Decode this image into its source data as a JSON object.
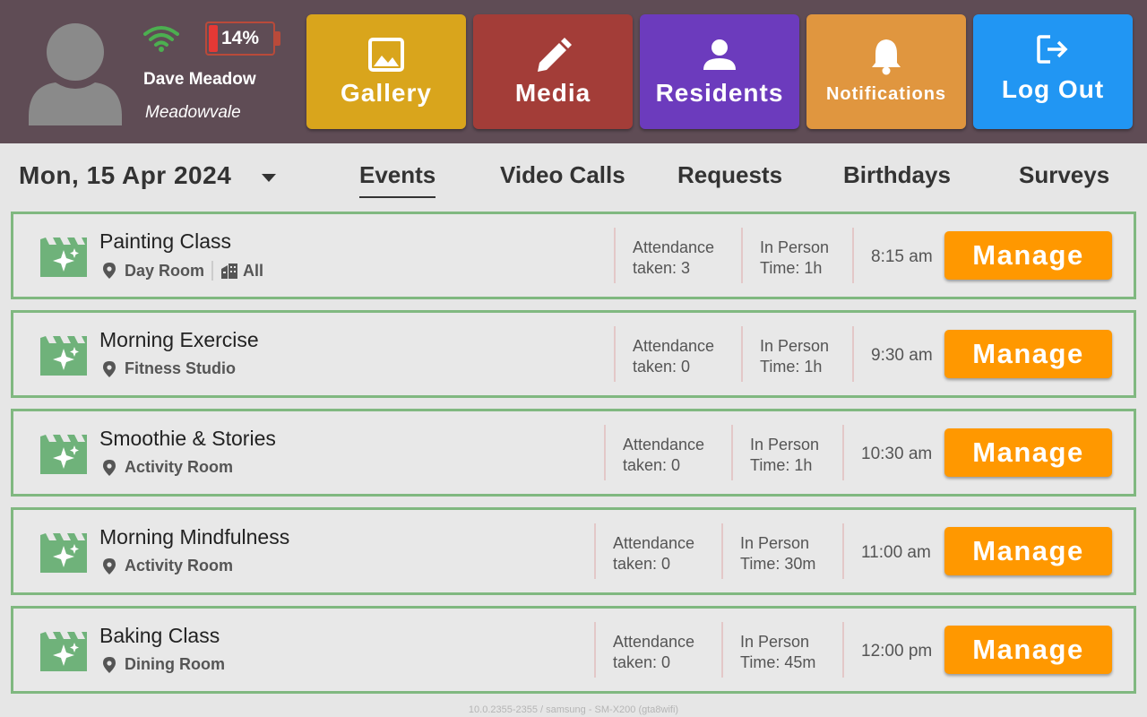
{
  "header": {
    "user_name": "Dave Meadow",
    "user_site": "Meadowvale",
    "battery_percent": 14,
    "battery_text": "14%",
    "nav": {
      "gallery": "Gallery",
      "media": "Media",
      "residents": "Residents",
      "notifications": "Notifications",
      "logout": "Log Out"
    }
  },
  "date": "Mon, 15 Apr 2024",
  "tabs": {
    "events": "Events",
    "video_calls": "Video Calls",
    "requests": "Requests",
    "birthdays": "Birthdays",
    "surveys": "Surveys"
  },
  "events": [
    {
      "title": "Painting Class",
      "location": "Day Room",
      "audience": "All",
      "attendance_label": "Attendance",
      "attendance_value": "taken: 3",
      "mode": "In Person",
      "duration": "Time: 1h",
      "time": "8:15 am",
      "manage": "Manage"
    },
    {
      "title": "Morning Exercise",
      "location": "Fitness Studio",
      "attendance_label": "Attendance",
      "attendance_value": "taken: 0",
      "mode": "In Person",
      "duration": "Time: 1h",
      "time": "9:30 am",
      "manage": "Manage"
    },
    {
      "title": "Smoothie & Stories",
      "location": "Activity Room",
      "attendance_label": "Attendance",
      "attendance_value": "taken: 0",
      "mode": "In Person",
      "duration": "Time: 1h",
      "time": "10:30 am",
      "manage": "Manage"
    },
    {
      "title": "Morning Mindfulness",
      "location": "Activity Room",
      "attendance_label": "Attendance",
      "attendance_value": "taken: 0",
      "mode": "In Person",
      "duration": "Time: 30m",
      "time": "11:00 am",
      "manage": "Manage"
    },
    {
      "title": "Baking Class",
      "location": "Dining Room",
      "attendance_label": "Attendance",
      "attendance_value": "taken: 0",
      "mode": "In Person",
      "duration": "Time: 45m",
      "time": "12:00 pm",
      "manage": "Manage"
    }
  ],
  "footer": "10.0.2355-2355 / samsung - SM-X200 (gta8wifi)",
  "colors": {
    "header_bg": "#5f4c55",
    "gallery": "#d9a51c",
    "media": "#a33d38",
    "residents": "#6c3bbd",
    "notifications": "#e0963f",
    "logout": "#2196f3",
    "manage": "#ff9800",
    "card_border": "#80b880",
    "event_icon": "#6fb27a",
    "wifi": "#4caf50",
    "battery_low": "#e53935"
  },
  "icons": {
    "avatar": "person-silhouette-icon",
    "wifi": "wifi-icon",
    "battery": "battery-icon",
    "gallery": "image-icon",
    "media": "pencil-icon",
    "residents": "person-icon",
    "notifications": "bell-icon",
    "logout": "logout-icon",
    "date_dropdown": "caret-down-icon",
    "event": "film-sparkle-icon",
    "location": "map-pin-icon",
    "audience": "building-icon"
  }
}
